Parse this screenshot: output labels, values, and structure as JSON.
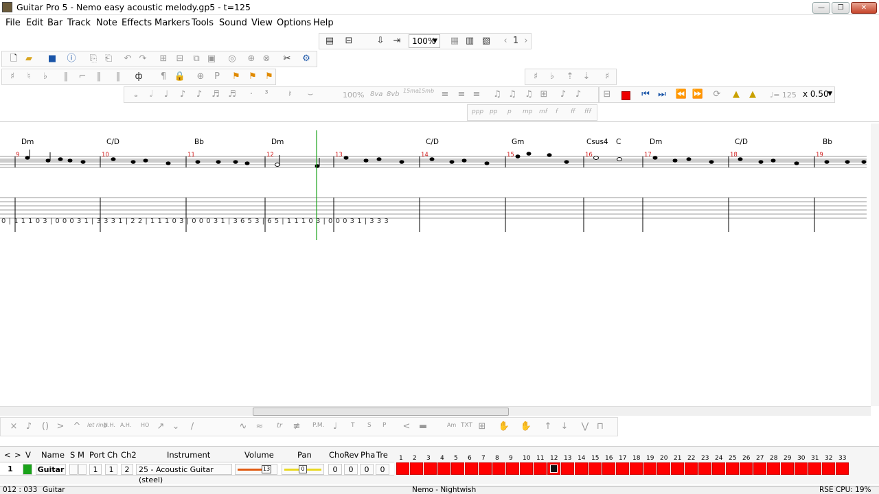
{
  "window": {
    "title": "Guitar Pro 5 - Nemo easy acoustic melody.gp5 - t=125",
    "minimize_label": "—",
    "restore_label": "❐",
    "close_label": "✕"
  },
  "menu": [
    "File",
    "Edit",
    "Bar",
    "Track",
    "Note",
    "Effects",
    "Markers",
    "Tools",
    "Sound",
    "View",
    "Options",
    "Help"
  ],
  "toolbar": {
    "zoom": "100%",
    "page": "1",
    "tempo": "♩= 125",
    "speed": "x 0.50",
    "dynamics": [
      "ppp",
      "pp",
      "p",
      "mp",
      "mf",
      "f",
      "ff",
      "fff"
    ],
    "velocity_label": "100%",
    "ottava": [
      "8va",
      "8vb",
      "15ma",
      "15mb"
    ]
  },
  "colors": {
    "accent": "#ff0000",
    "cursor": "#1aa31a",
    "bar_number": "#d01c1c"
  },
  "score": {
    "chords": [
      {
        "bar": 9,
        "label": "Dm"
      },
      {
        "bar": 10,
        "label": "C/D"
      },
      {
        "bar": 11,
        "label": "Bb"
      },
      {
        "bar": 12,
        "label": "Dm"
      },
      {
        "bar": 14,
        "label": "C/D"
      },
      {
        "bar": 15,
        "label": "Gm"
      },
      {
        "bar": 16,
        "label": "Csus4"
      },
      {
        "bar": 16,
        "label": "C"
      },
      {
        "bar": 17,
        "label": "Dm"
      },
      {
        "bar": 18,
        "label": "C/D"
      },
      {
        "bar": 19,
        "label": "Bb"
      }
    ],
    "bar_numbers": [
      "9",
      "10",
      "11",
      "12",
      "13",
      "14",
      "15",
      "16",
      "17",
      "18",
      "19"
    ],
    "tab_line": "0 | 1 1 1 0 3 | 0 0 0 3 1 | 3 3 3 1 | 2 2 | 1 1 1 0 3 | 0 0 0 3 1 | 3 6 5 3 | 6 5 | 1 1 1 0 3 | 0 0 0 3 1 | 3 3 3"
  },
  "effects_bar": {
    "items": [
      "let ring",
      "N.H.",
      "A.H.",
      "HO",
      "tr",
      "P.M.",
      "T",
      "S",
      "P",
      "TXT",
      "Am"
    ]
  },
  "tracks": {
    "headers": [
      "<",
      ">",
      "V",
      "Name",
      "S",
      "M",
      "Port",
      "Ch",
      "Ch2",
      "Instrument",
      "Volume",
      "Pan",
      "Cho",
      "Rev",
      "Pha",
      "Tre"
    ],
    "rows": [
      {
        "number": "1",
        "name": "Guitar",
        "port": "1",
        "ch": "1",
        "ch2": "2",
        "instrument": "25 - Acoustic Guitar (steel)",
        "volume": "13",
        "pan": "0",
        "cho": "0",
        "rev": "0",
        "pha": "0",
        "tre": "0"
      }
    ],
    "bar_numbers": [
      "1",
      "2",
      "3",
      "4",
      "5",
      "6",
      "7",
      "8",
      "9",
      "10",
      "11",
      "12",
      "13",
      "14",
      "15",
      "16",
      "17",
      "18",
      "19",
      "20",
      "21",
      "22",
      "23",
      "24",
      "25",
      "26",
      "27",
      "28",
      "29",
      "30",
      "31",
      "32",
      "33"
    ],
    "current_bar": "12"
  },
  "status": {
    "position": "012 : 033",
    "track": "Guitar",
    "song": "Nemo - Nightwish",
    "cpu": "RSE CPU: 19%"
  }
}
